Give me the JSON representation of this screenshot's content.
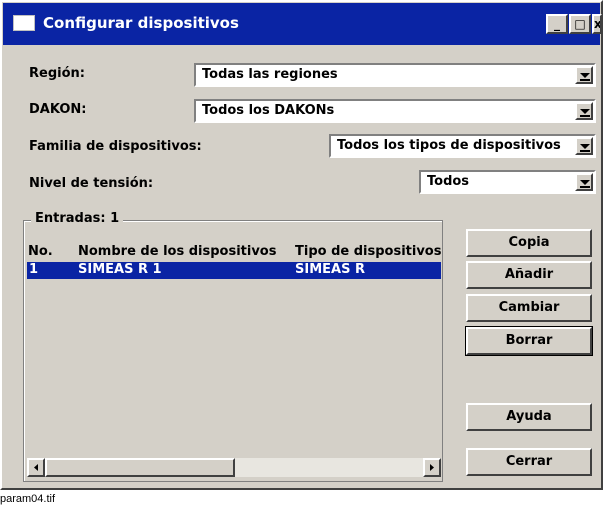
{
  "window": {
    "title": "Configurar dispositivos",
    "minimize": "_",
    "maximize": "□",
    "close": "x"
  },
  "filters": {
    "region_label": "Región:",
    "region_value": "Todas las regiones",
    "dakon_label": "DAKON:",
    "dakon_value": "Todos los DAKONs",
    "family_label": "Familia de dispositivos:",
    "family_value": "Todos los tipos de dispositivos",
    "voltage_label": "Nivel de tensión:",
    "voltage_value": "Todos"
  },
  "entries": {
    "group_label": "Entradas: 1",
    "columns": [
      "No.",
      "Nombre de los dispositivos",
      "Tipo de dispositivos"
    ],
    "rows": [
      {
        "no": "1",
        "name": "SIMEAS R 1",
        "type": "SIMEAS R"
      }
    ]
  },
  "buttons": {
    "copy": "Copia",
    "add": "Añadir",
    "change": "Cambiar",
    "delete": "Borrar",
    "help": "Ayuda",
    "close": "Cerrar"
  },
  "caption": "param04.tif",
  "colors": {
    "titlebar": "#0a24a4",
    "face": "#d4d0c8",
    "selection": "#0a24a4"
  }
}
